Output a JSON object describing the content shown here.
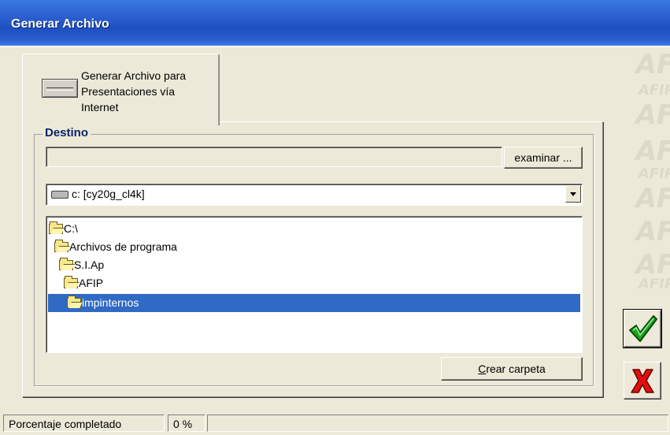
{
  "window": {
    "title": "Generar Archivo"
  },
  "tab": {
    "label_lines": [
      "Generar Archivo para",
      "Presentaciones vía",
      "Internet"
    ],
    "icon": "drive-icon"
  },
  "destino": {
    "group_title": "Destino",
    "path_value": "",
    "examinar_label": "examinar ...",
    "drive": {
      "selected": "c: [cy20g_cl4k]",
      "icon": "hard-drive-icon"
    },
    "tree": [
      {
        "label": "C:\\",
        "level": 0,
        "selected": false
      },
      {
        "label": "Archivos de programa",
        "level": 1,
        "selected": false
      },
      {
        "label": "S.I.Ap",
        "level": 2,
        "selected": false
      },
      {
        "label": "AFIP",
        "level": 3,
        "selected": false
      },
      {
        "label": "impinternos",
        "level": 4,
        "selected": true
      }
    ],
    "crear_carpeta": {
      "pre": "",
      "accel": "C",
      "post": "rear carpeta"
    }
  },
  "actions": {
    "ok_icon": "checkmark-icon",
    "cancel_icon": "x-icon",
    "ok_color": "#1aa01a",
    "cancel_color": "#e01010"
  },
  "status": {
    "label": "Porcentaje completado",
    "percent": "0 %",
    "progress_fraction": 0
  },
  "colors": {
    "titlebar": "#2d63d4",
    "selection": "#316ac5",
    "group_title": "#0a246a"
  }
}
